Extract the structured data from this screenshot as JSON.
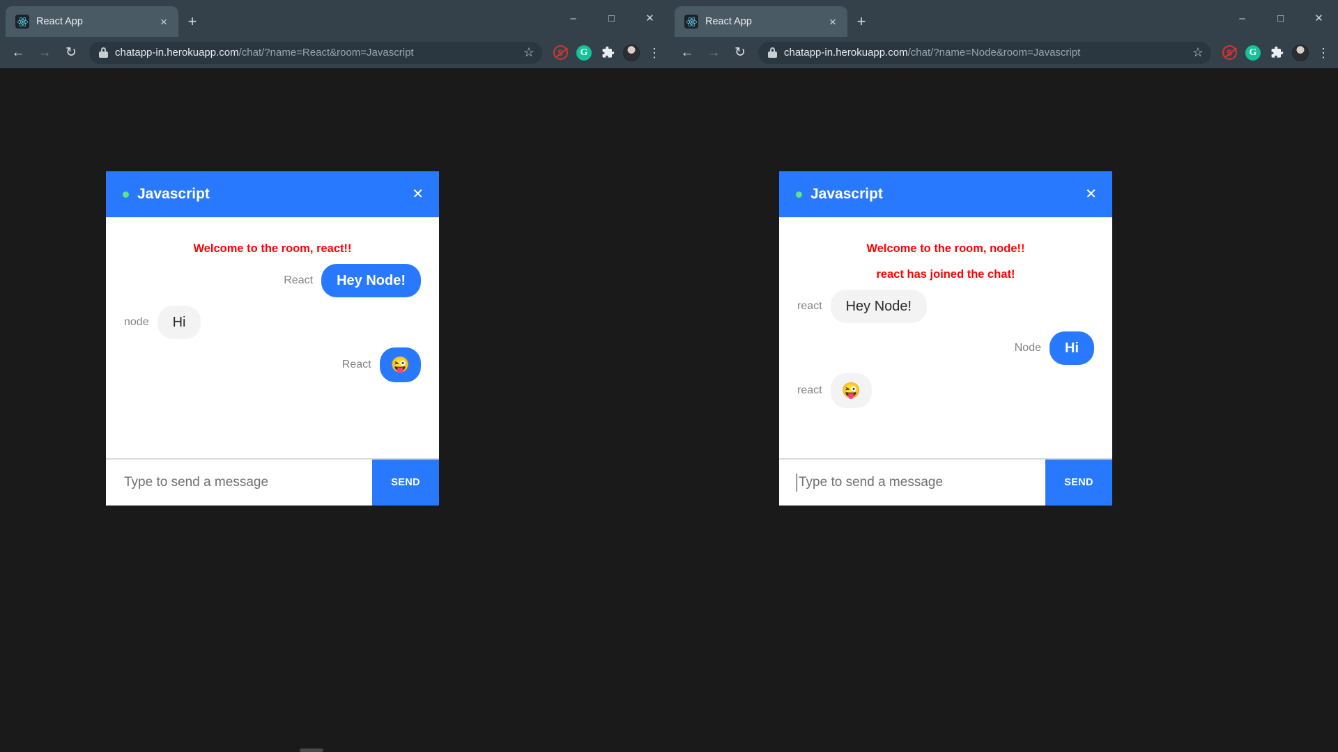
{
  "windows": [
    {
      "id": "left",
      "tab": {
        "title": "React App",
        "favicon": "react-logo-icon",
        "close": "×",
        "newtab": "+"
      },
      "window_controls": {
        "minimize": "–",
        "maximize": "□",
        "close": "✕"
      },
      "toolbar": {
        "back": "←",
        "forward": "→",
        "reload": "↻",
        "lock": "lock-icon",
        "url_host": "chatapp-in.herokuapp.com",
        "url_path": "/chat/?name=React&room=Javascript",
        "star": "☆",
        "extensions": [
          "adblock-icon",
          "grammarly-icon",
          "puzzle-icon",
          "profile-avatar",
          "kebab-menu-icon"
        ],
        "adblock_letter": "S",
        "grammarly_letter": "G",
        "puzzle_glyph": "❖",
        "kebab_glyph": "⋮"
      },
      "chat": {
        "room": "Javascript",
        "close_label": "✕",
        "system_messages": [
          "Welcome to the room, react!!"
        ],
        "messages": [
          {
            "align": "right",
            "who": "React",
            "text": "Hey Node!",
            "style": "blue",
            "is_emoji": false
          },
          {
            "align": "left",
            "who": "node",
            "text": "Hi",
            "style": "gray",
            "is_emoji": false
          },
          {
            "align": "right",
            "who": "React",
            "text": "😜",
            "style": "blue",
            "is_emoji": true
          }
        ],
        "composer": {
          "placeholder": "Type to send a message",
          "value": "",
          "send_label": "SEND",
          "focused": false
        }
      }
    },
    {
      "id": "right",
      "tab": {
        "title": "React App",
        "favicon": "react-logo-icon",
        "close": "×",
        "newtab": "+"
      },
      "window_controls": {
        "minimize": "–",
        "maximize": "□",
        "close": "✕"
      },
      "toolbar": {
        "back": "←",
        "forward": "→",
        "reload": "↻",
        "lock": "lock-icon",
        "url_host": "chatapp-in.herokuapp.com",
        "url_path": "/chat/?name=Node&room=Javascript",
        "star": "☆",
        "extensions": [
          "adblock-icon",
          "grammarly-icon",
          "puzzle-icon",
          "profile-avatar",
          "kebab-menu-icon"
        ],
        "adblock_letter": "S",
        "grammarly_letter": "G",
        "puzzle_glyph": "❖",
        "kebab_glyph": "⋮"
      },
      "chat": {
        "room": "Javascript",
        "close_label": "✕",
        "system_messages": [
          "Welcome to the room, node!!",
          "react has joined the chat!"
        ],
        "messages": [
          {
            "align": "left",
            "who": "react",
            "text": "Hey Node!",
            "style": "gray",
            "is_emoji": false
          },
          {
            "align": "right",
            "who": "Node",
            "text": "Hi",
            "style": "blue",
            "is_emoji": false
          },
          {
            "align": "left",
            "who": "react",
            "text": "😜",
            "style": "gray",
            "is_emoji": true
          }
        ],
        "composer": {
          "placeholder": "Type to send a message",
          "value": "",
          "send_label": "SEND",
          "focused": true
        }
      }
    }
  ],
  "colors": {
    "brand_blue": "#2979ff",
    "system_red": "#ff0000",
    "chrome_frame": "#35414a",
    "tab_active": "#4a5a64",
    "omnibox": "#2a3640",
    "page_bg": "#1a1a1a",
    "bubble_gray": "#f3f3f3",
    "online_green": "#5fe28b"
  }
}
